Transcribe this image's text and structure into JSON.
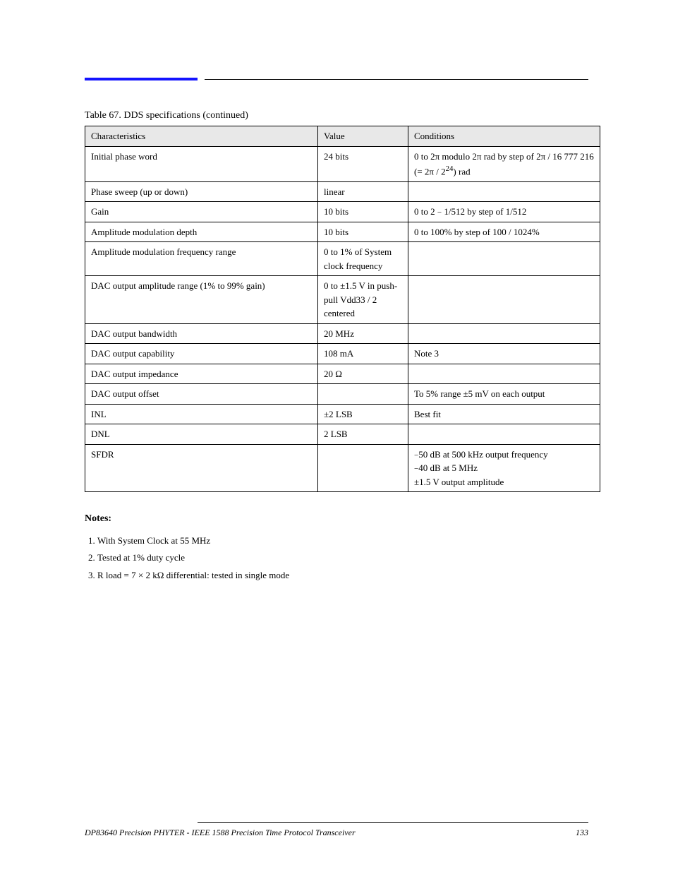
{
  "caption": "Table 67. DDS specifications (continued)",
  "header": {
    "c1": "Characteristics",
    "c2": "Value",
    "c3": "Conditions"
  },
  "rows": [
    {
      "c1": "Initial phase word",
      "c2": "24 bits",
      "c3": "0 to 2π modulo 2π rad by step of 2π / 16 777 216 (= 2π / 2<sup>24</sup>) rad"
    },
    {
      "c1": "Phase sweep (up or down)",
      "c2": "linear",
      "c3": ""
    },
    {
      "c1": "Gain",
      "c2": "10 bits",
      "c3": "0 to 2 <span style=\"font-size:11px\">−</span> 1/512 by step of 1/512"
    },
    {
      "c1": "Amplitude modulation depth",
      "c2": "10 bits",
      "c3": "0 to 100<span style=\"font-family:Georgia\">%</span> by step of 100 / 1024<span style=\"font-family:Georgia\">%</span>"
    },
    {
      "c1": "Amplitude modulation frequency range",
      "c2": "0 to 1<span style=\"font-family:Georgia\">%</span> of System clock frequency",
      "c3": ""
    },
    {
      "c1": "DAC output amplitude range (1<span style=\"font-family:Georgia\">%</span> to 99<span style=\"font-family:Georgia\">%</span> gain)",
      "c2": "0 to ±1.5 V in push-pull Vdd33 / 2 centered",
      "c3": ""
    },
    {
      "c1": "DAC output bandwidth",
      "c2": "20 MHz",
      "c3": ""
    },
    {
      "c1": "DAC output capability",
      "c2": "108 mA",
      "c3": "Note 3"
    },
    {
      "c1": "DAC output impedance",
      "c2": "20 Ω",
      "c3": ""
    },
    {
      "c1": "DAC output offset",
      "c2": "",
      "c3": "To 5% range ±5 mV on each output"
    },
    {
      "c1": "INL",
      "c2": "±2 LSB",
      "c3": "Best fit"
    },
    {
      "c1": "DNL",
      "c2": "2 LSB",
      "c3": ""
    },
    {
      "c1": "SFDR",
      "c2": "",
      "c3": "<span style=\"font-size:11px\">−</span>50 dB at 500 kHz output frequency<br><span style=\"font-size:11px\">−</span>40 dB at 5 MHz<br>±1.5 V output amplitude"
    }
  ],
  "notes_heading": "Notes:",
  "notes": [
    "With System Clock at 55 MHz",
    "Tested at 1% duty cycle",
    "R load = 7 × 2 kΩ differential: tested in single mode"
  ],
  "footer_left": "DP83640 Precision PHYTER - IEEE 1588 Precision Time Protocol Transceiver",
  "footer_right": "133"
}
